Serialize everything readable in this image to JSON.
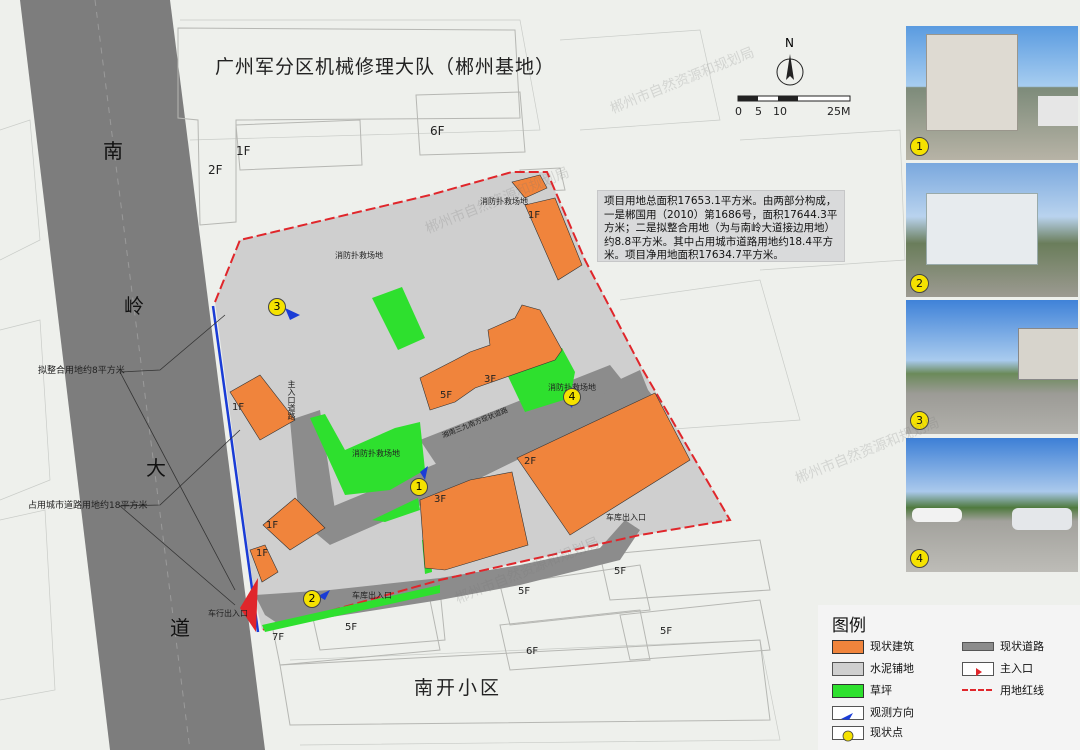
{
  "title": "广州军分区机械修理大队（郴州基地）",
  "road_name_chars": [
    "南",
    "岭",
    "大",
    "道"
  ],
  "community_name": "南开小区",
  "compass": {
    "north_label": "N"
  },
  "scale_bar": {
    "labels": [
      "0",
      "5",
      "10",
      "25M"
    ]
  },
  "info_text": "项目用地总面积17653.1平方米。由两部分构成，一是郴国用（2010）第1686号，面积17644.3平方米；二是拟整合用地（为与南岭大道接边用地）约8.8平方米。其中占用城市道路用地约18.4平方米。项目净用地面积17634.7平方米。",
  "side_labels": {
    "integrated_land": "拟整合用地约8平方米",
    "city_road_land": "占用城市道路用地约18平方米"
  },
  "site_labels": {
    "fire_rescue_top": "消防扑救场地",
    "fire_rescue_road": "消防扑救场地",
    "fire_rescue_mid": "消防扑救场地",
    "fire_rescue_right": "消防扑救场地",
    "vehicle_entrance": "车行出入口",
    "garage_entrance_bottom": "车库出入口",
    "garage_entrance_right": "车库出入口",
    "main_road_label": "主入口道路",
    "inner_road_label": "湘南三九南方现状道路"
  },
  "floor_labels": {
    "b_2f_top": "2F",
    "b_1f_top": "1F",
    "b_6f_top": "6F",
    "b_1f_right_top": "1F",
    "b_5f": "5F",
    "b_3f_mid": "3F",
    "b_1f_left": "1F",
    "b_2f_right": "2F",
    "b_3f_center": "3F",
    "b_1f_small1": "1F",
    "b_1f_small2": "1F",
    "b_7f": "7F",
    "b_5f_bottom1": "5F",
    "b_5f_bottom2": "5F",
    "b_5f_bottom3": "5F",
    "b_6f_bottom": "6F",
    "b_5f_bottom4": "5F"
  },
  "observation_points": [
    "1",
    "2",
    "3",
    "4"
  ],
  "photos": [
    {
      "num": "1",
      "alt": "现状照片1"
    },
    {
      "num": "2",
      "alt": "现状照片2"
    },
    {
      "num": "3",
      "alt": "现状照片3"
    },
    {
      "num": "4",
      "alt": "现状照片4"
    }
  ],
  "legend": {
    "title": "图例",
    "items": [
      {
        "key": "existing_building",
        "label": "现状建筑",
        "color": "#f0843c"
      },
      {
        "key": "existing_road",
        "label": "现状道路",
        "color": "#8c8c8c"
      },
      {
        "key": "concrete",
        "label": "水泥铺地",
        "color": "#cfcfcf"
      },
      {
        "key": "main_entrance",
        "label": "主入口",
        "color": "#e0262b"
      },
      {
        "key": "lawn",
        "label": "草坪",
        "color": "#2ee02e"
      },
      {
        "key": "red_line",
        "label": "用地红线",
        "color": "#e0262b"
      },
      {
        "key": "observe_dir",
        "label": "观测方向",
        "color": "#1a3cd6"
      },
      {
        "key": "status_point",
        "label": "现状点",
        "color": "#f5e200"
      }
    ]
  },
  "watermark": "郴州市自然资源和规划局",
  "colors": {
    "building": "#f0843c",
    "concrete": "#cfcfcf",
    "road": "#8c8c8c",
    "lawn": "#2ee02e",
    "redline": "#e0262b",
    "blueline": "#1a3cd6",
    "bigroad": "#7d7d7d"
  }
}
